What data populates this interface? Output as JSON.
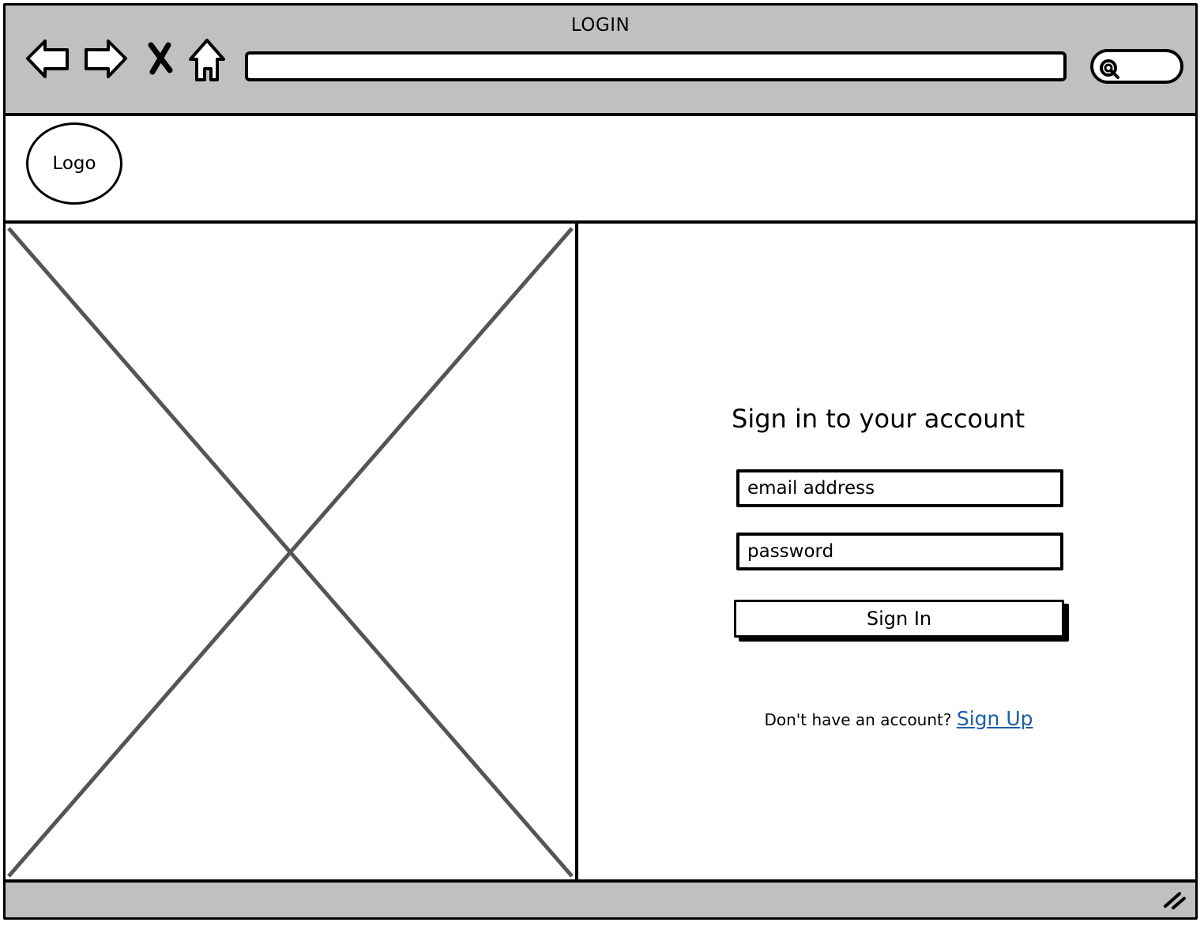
{
  "window": {
    "title": "LOGIN"
  },
  "toolbar": {
    "icons": [
      "back-arrow-icon",
      "forward-arrow-icon",
      "stop-icon",
      "home-icon"
    ],
    "address_value": "",
    "search_icon": "search-icon"
  },
  "header": {
    "logo_label": "Logo"
  },
  "image_placeholder": {
    "icon": "image-placeholder-cross"
  },
  "login": {
    "title": "Sign in to your account",
    "email_placeholder": "email address",
    "password_placeholder": "password",
    "signin_label": "Sign In",
    "signup_prompt": "Don't have an account?",
    "signup_link": "Sign Up"
  },
  "colors": {
    "chrome": "#c0c0c0",
    "border": "#000000",
    "link": "#1a5fa8",
    "placeholder_cross": "#555555"
  }
}
